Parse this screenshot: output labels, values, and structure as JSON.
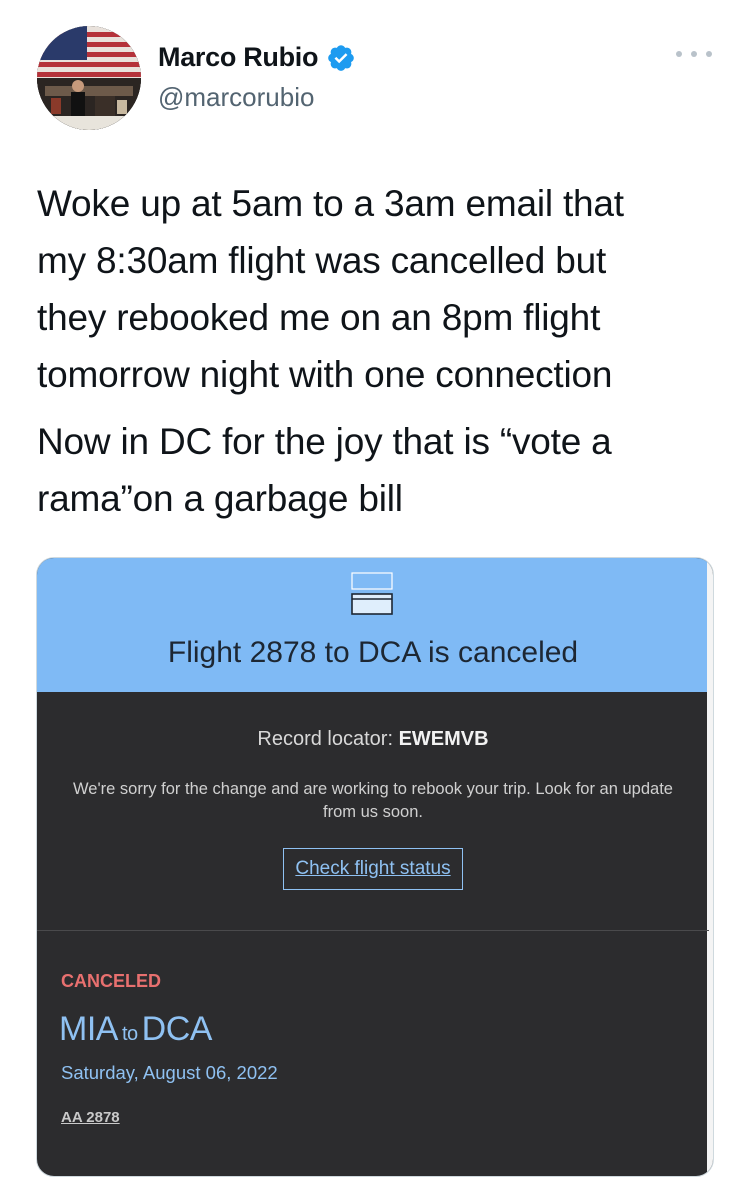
{
  "author": {
    "name": "Marco Rubio",
    "handle": "@marcorubio"
  },
  "tweet": {
    "paragraphs": [
      "Woke up at 5am to a 3am email that\nmy 8:30am flight was cancelled but\nthey rebooked me on an 8pm flight\ntomorrow night with one connection",
      "Now in DC for the joy that is “vote a\nrama”on a garbage bill"
    ]
  },
  "email": {
    "title": "Flight 2878 to DCA is canceled",
    "record_label": "Record locator:",
    "record_value": "EWEMVB",
    "message": "We're sorry for the change and are working to rebook your trip. Look for an update from us soon.",
    "status_button": "Check flight status",
    "canceled_label": "CANCELED",
    "origin": "MIA",
    "to_word": "to",
    "destination": "DCA",
    "date": "Saturday, August 06, 2022",
    "flight_code": "AA 2878"
  },
  "colors": {
    "header_blue": "#7fbaf5",
    "email_dark": "#2c2c2e",
    "link_blue": "#8fc1f2",
    "canceled_red": "#e8706f",
    "verified_blue": "#1d9bf0"
  }
}
